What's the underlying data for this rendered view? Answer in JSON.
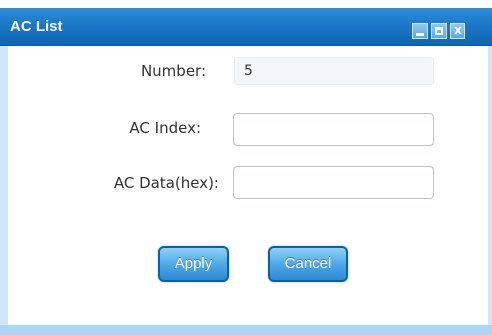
{
  "window": {
    "title": "AC List",
    "controls": {
      "minimize_icon": "minimize-icon",
      "maximize_icon": "maximize-icon",
      "close_icon": "close-icon",
      "close_glyph": "x"
    },
    "colors": {
      "titlebar": "#1a78c8",
      "frame": "#cfe8f8",
      "button_border": "#0d5fa8"
    }
  },
  "form": {
    "number": {
      "label": "Number:",
      "value": "5"
    },
    "ac_index": {
      "label": "AC Index:",
      "value": ""
    },
    "ac_data": {
      "label": "AC Data(hex):",
      "value": ""
    }
  },
  "buttons": {
    "apply_label": "Apply",
    "cancel_label": "Cancel"
  }
}
